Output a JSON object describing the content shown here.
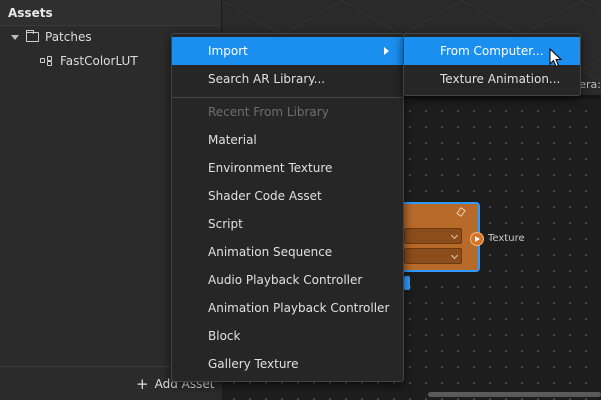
{
  "assets": {
    "title": "Assets",
    "tree": [
      {
        "label": "Patches",
        "icon": "folder-icon",
        "expanded": true
      },
      {
        "label": "FastColorLUT",
        "icon": "patch-icon"
      }
    ],
    "add_asset_label": "Add Asset"
  },
  "viewport": {
    "camera_label": "era:"
  },
  "patch_node": {
    "output_label": "Texture"
  },
  "context_menu": {
    "items": [
      {
        "label": "Import",
        "highlighted": true,
        "has_submenu": true
      },
      {
        "label": "Search AR Library...",
        "highlighted": false
      }
    ],
    "section_header": "Recent From Library",
    "recent_items": [
      "Material",
      "Environment Texture",
      "Shader Code Asset",
      "Script",
      "Animation Sequence",
      "Audio Playback Controller",
      "Animation Playback Controller",
      "Block",
      "Gallery Texture"
    ]
  },
  "import_submenu": {
    "items": [
      {
        "label": "From Computer...",
        "highlighted": true
      },
      {
        "label": "Texture Animation...",
        "highlighted": false
      }
    ]
  },
  "colors": {
    "highlight": "#1b8fef",
    "menu_bg": "#262626",
    "node_orange": "#b86a2b",
    "selection_blue": "#2f9bff"
  }
}
